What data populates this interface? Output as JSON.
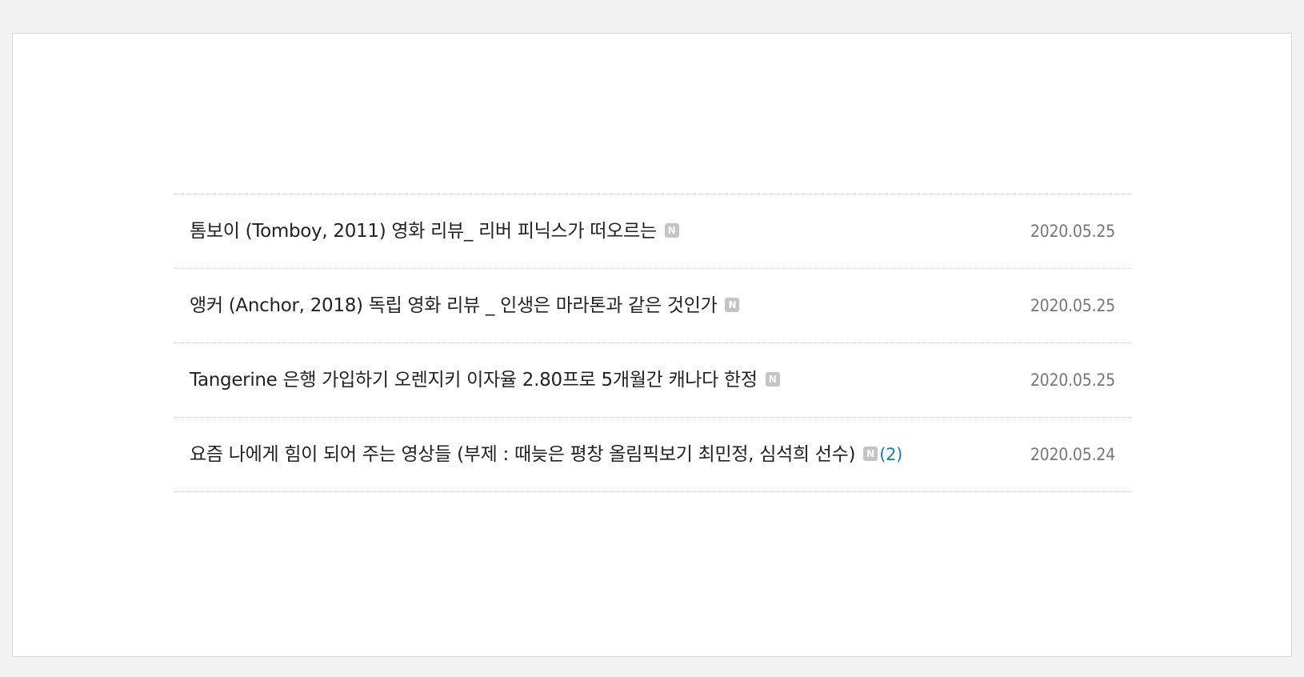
{
  "posts": [
    {
      "title": "톰보이 (Tomboy, 2011) 영화 리뷰_ 리버 피닉스가 떠오르는",
      "badge": "N",
      "comments": "",
      "date": "2020.05.25"
    },
    {
      "title": "앵커 (Anchor, 2018) 독립 영화 리뷰 _ 인생은 마라톤과 같은 것인가",
      "badge": "N",
      "comments": "",
      "date": "2020.05.25"
    },
    {
      "title": "Tangerine 은행 가입하기 오렌지키 이자율 2.80프로 5개월간 캐나다 한정",
      "badge": "N",
      "comments": "",
      "date": "2020.05.25"
    },
    {
      "title": "요즘 나에게 힘이 되어 주는 영상들 (부제 : 때늦은 평창 올림픽보기 최민정, 심석희 선수)",
      "badge": "N",
      "comments": "(2)",
      "date": "2020.05.24"
    }
  ],
  "colors": {
    "background": "#f2f2f2",
    "panel": "#ffffff",
    "title_text": "#222222",
    "date_text": "#777777",
    "comment_count": "#1f7bb0",
    "badge": "#c4c4c4"
  }
}
